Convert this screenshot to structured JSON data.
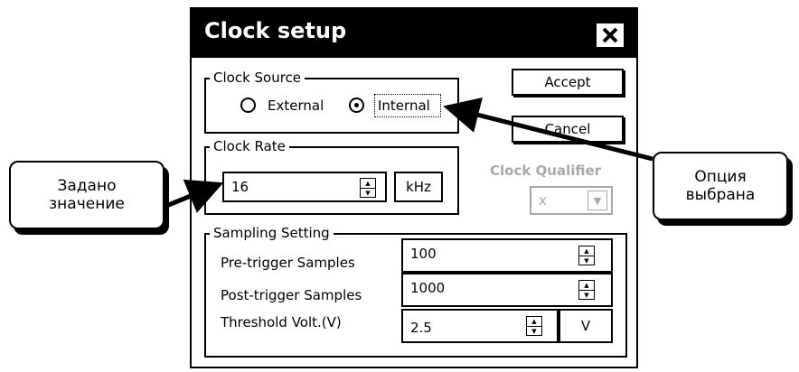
{
  "dialog": {
    "title": "Clock setup",
    "close_label": "X",
    "clock_source": {
      "legend": "Clock Source",
      "options": [
        {
          "label": "External",
          "selected": false
        },
        {
          "label": "Internal",
          "selected": true
        }
      ]
    },
    "clock_rate": {
      "legend": "Clock Rate",
      "value": "16",
      "unit": "kHz"
    },
    "buttons": {
      "accept": "Accept",
      "cancel": "Cancel"
    },
    "clock_qualifier": {
      "label": "Clock Qualifier",
      "value": "x"
    },
    "sampling": {
      "legend": "Sampling Setting",
      "rows": [
        {
          "label": "Pre-trigger Samples",
          "value": "100"
        },
        {
          "label": "Post-trigger Samples",
          "value": "1000"
        },
        {
          "label": "Threshold Volt.(V)",
          "value": "2.5",
          "unit": "V"
        }
      ]
    }
  },
  "callouts": {
    "left": "Задано значение",
    "right": "Опция выбрана"
  },
  "colors": {
    "titlebar": "#000000",
    "disabled": "#a8a8a8"
  }
}
